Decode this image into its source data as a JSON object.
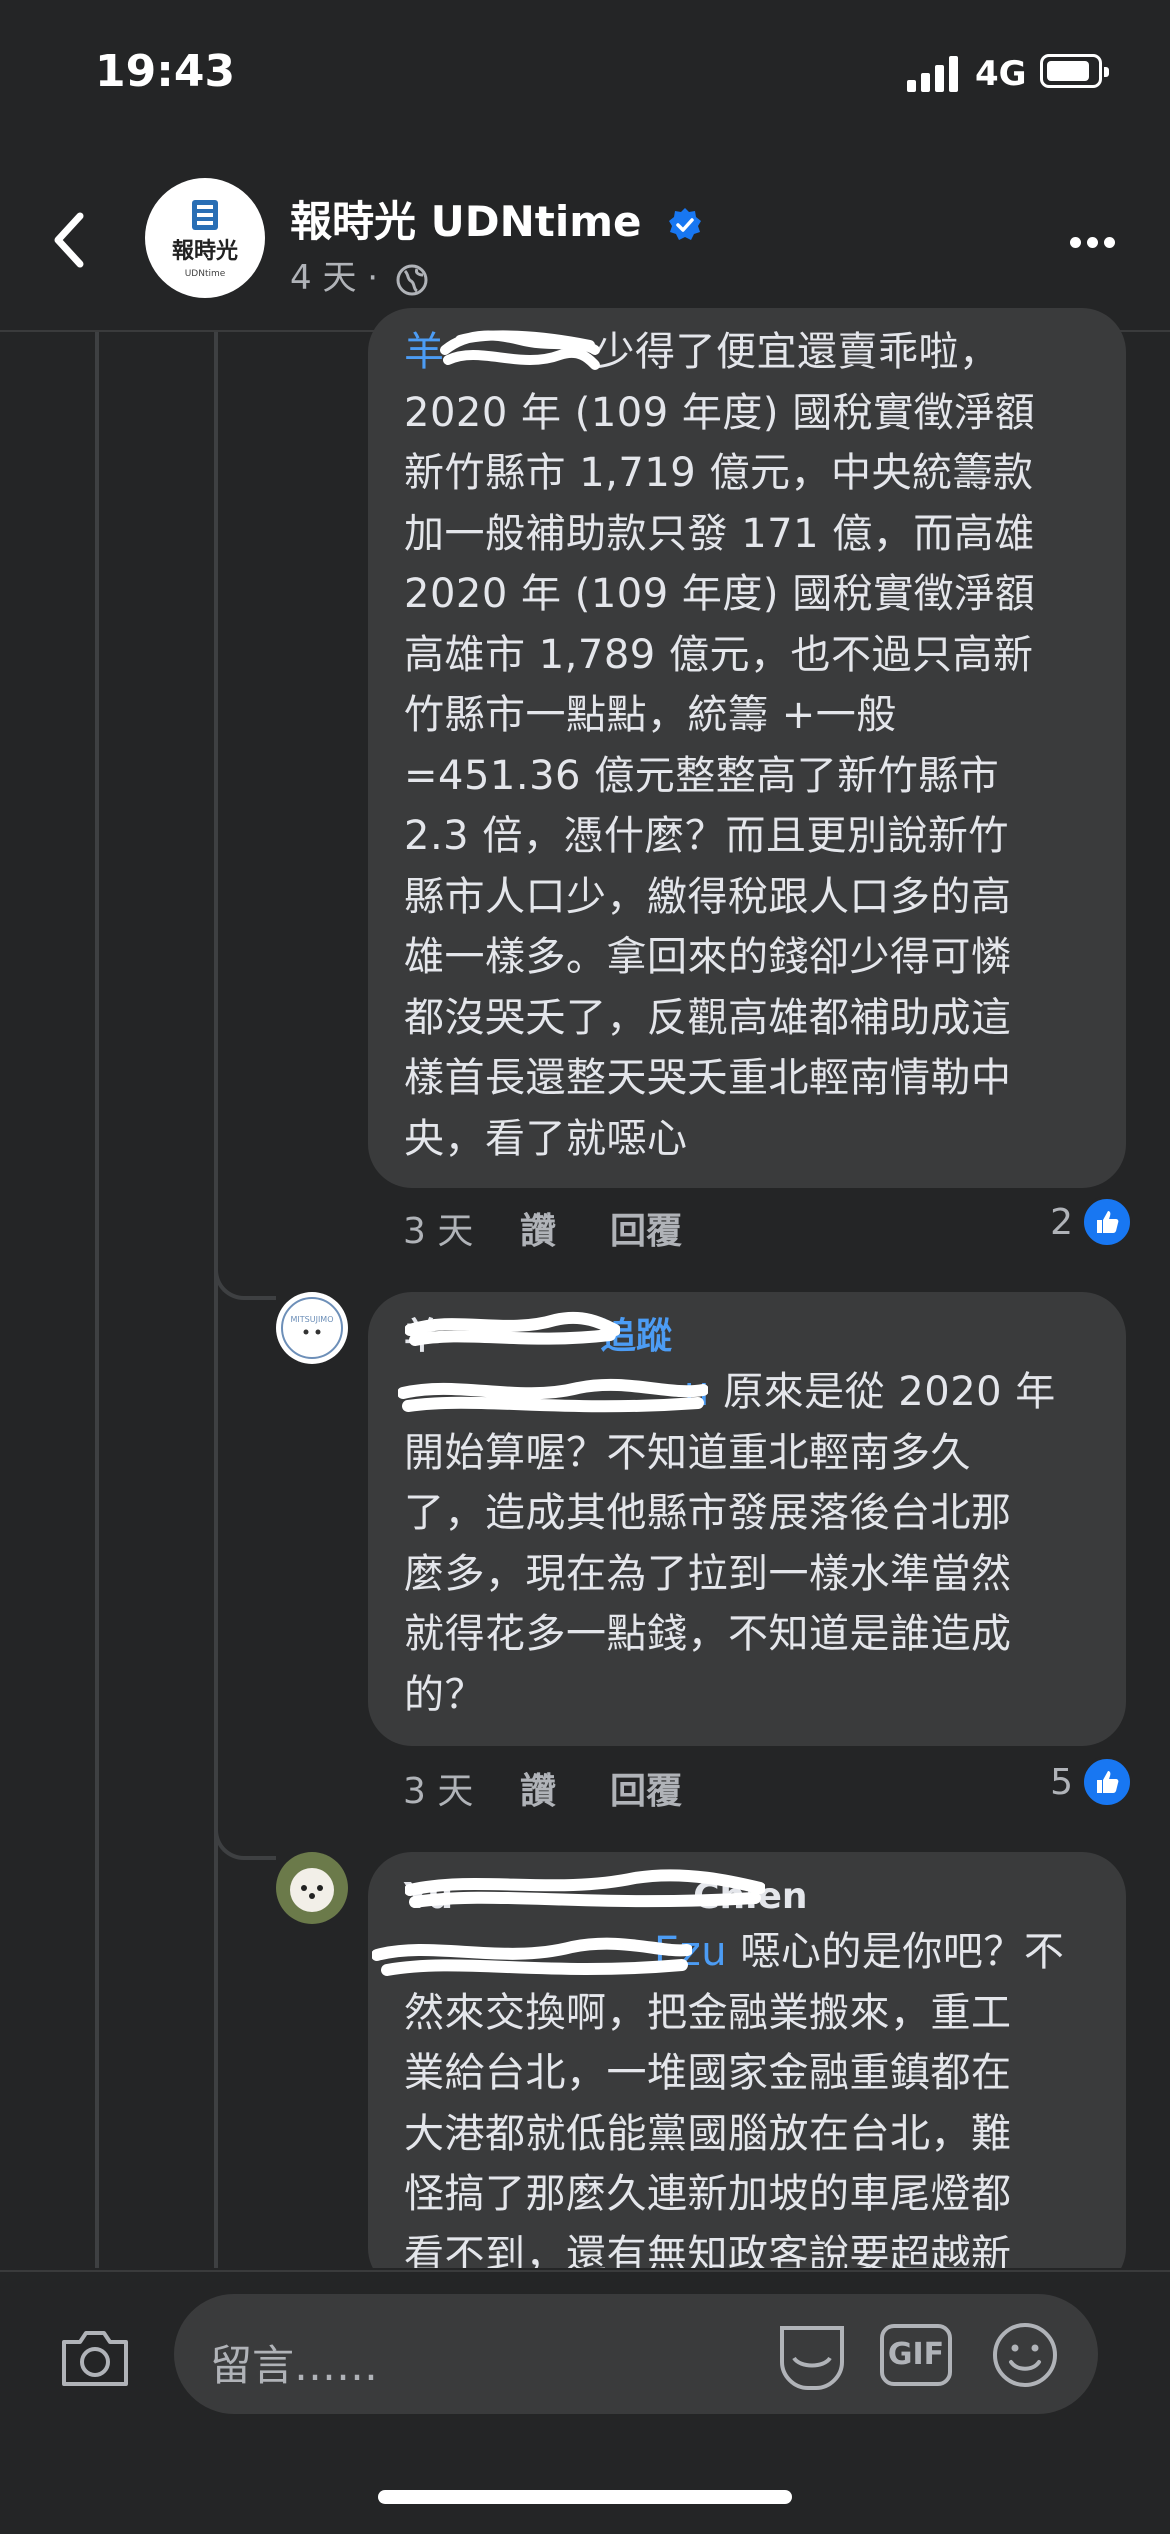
{
  "status_bar": {
    "time": "19:43",
    "network": "4G"
  },
  "header": {
    "page_name": "報時光 UDNtime",
    "post_age": "4 天",
    "separator": "·",
    "logo_text": "報時光",
    "logo_subtext": "UDNtime"
  },
  "comments": [
    {
      "mention": "羊",
      "text_first": "少得了便宜還賣乖啦，",
      "text": "2020 年 (109 年度) 國稅實徵淨額\n新竹縣市 1,719 億元，中央統籌款\n加一般補助款只發 171 億，而高雄\n 2020 年 (109 年度) 國稅實徵淨額\n高雄市 1,789 億元，也不過只高新\n竹縣市一點點，統籌 +一般\n=451.36 億元整整高了新竹縣市\n 2.3 倍，憑什麼？而且更別說新竹\n縣市人口少，繳得稅跟人口多的高\n雄一樣多。拿回來的錢卻少得可憐\n都沒哭夭了，反觀高雄都補助成這\n樣首長還整天哭夭重北輕南情勒中\n央，看了就噁心",
      "age": "3 天",
      "like_label": "讚",
      "reply_label": "回覆",
      "reactions": "2"
    },
    {
      "author": "羊",
      "author_tail": "追蹤",
      "mention_tail": "u",
      "text_first": "原來是從 2020 年",
      "text": "開始算喔？不知道重北輕南多久\n了，造成其他縣市發展落後台北那\n麼多，現在為了拉到一樣水準當然\n就得花多一點錢，不知道是誰造成\n的？",
      "age": "3 天",
      "like_label": "讚",
      "reply_label": "回覆",
      "reactions": "5",
      "avatar_text": "MITSUJIMO"
    },
    {
      "author": "Yu",
      "author_tail": "Chien",
      "mention_tail": "Ezu",
      "text_first": "噁心的是你吧？不",
      "text": "然來交換啊，把金融業搬來，重工\n業給台北，一堆國家金融重鎮都在\n大港都就低能黨國腦放在台北，難\n怪搞了那麼久連新加坡的車尾燈都\n看不到，還有無知政客說要超越新"
    }
  ],
  "composer": {
    "placeholder": "留言……",
    "gif_label": "GIF"
  }
}
